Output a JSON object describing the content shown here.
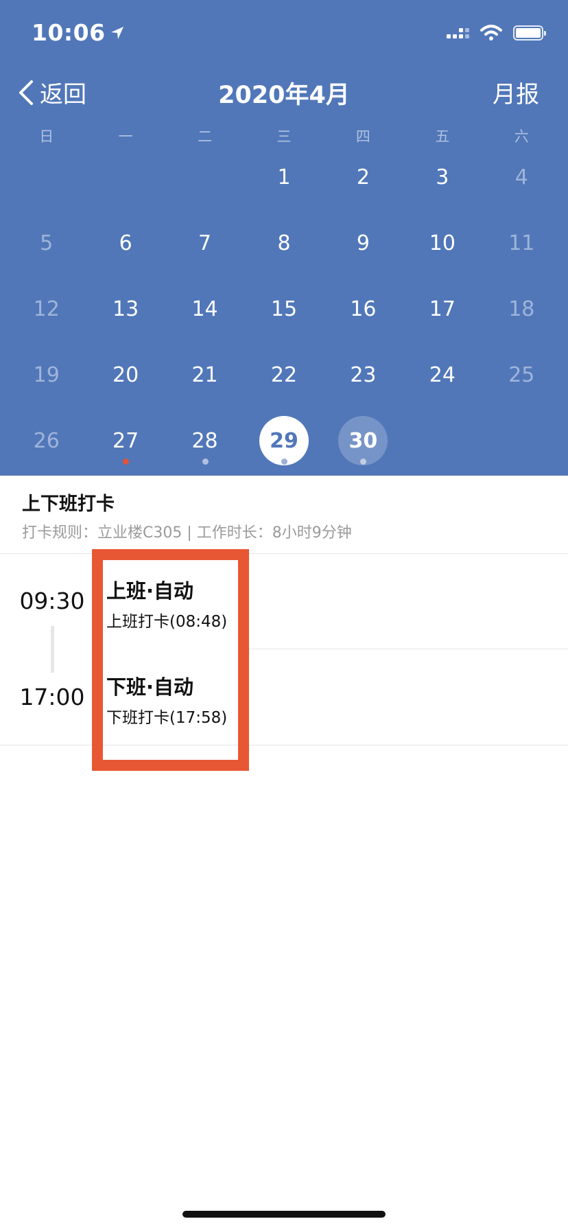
{
  "status_bar": {
    "time": "10:06"
  },
  "nav": {
    "back_label": "返回",
    "title": "2020年4月",
    "report_label": "月报"
  },
  "calendar": {
    "weekdays": [
      "日",
      "一",
      "二",
      "三",
      "四",
      "五",
      "六"
    ],
    "weeks": [
      [
        null,
        null,
        null,
        "1",
        "2",
        "3",
        "4"
      ],
      [
        "5",
        "6",
        "7",
        "8",
        "9",
        "10",
        "11"
      ],
      [
        "12",
        "13",
        "14",
        "15",
        "16",
        "17",
        "18"
      ],
      [
        "19",
        "20",
        "21",
        "22",
        "23",
        "24",
        "25"
      ],
      [
        "26",
        "27",
        "28",
        "29",
        "30",
        null,
        null
      ]
    ],
    "selected_day": "29",
    "today_day": "30",
    "marked_days": {
      "27": "red",
      "28": "gray",
      "29": "gray",
      "30": "gray"
    }
  },
  "section": {
    "title": "上下班打卡",
    "rule_text": "打卡规则：立业楼C305 | 工作时长：8小时9分钟"
  },
  "entries": [
    {
      "time": "09:30",
      "title": "上班·自动",
      "detail": "上班打卡(08:48)"
    },
    {
      "time": "17:00",
      "title": "下班·自动",
      "detail": "下班打卡(17:58)"
    }
  ],
  "colors": {
    "header_bg": "#5177b9",
    "highlight": "#e85734",
    "red_dot": "#e4533c"
  }
}
